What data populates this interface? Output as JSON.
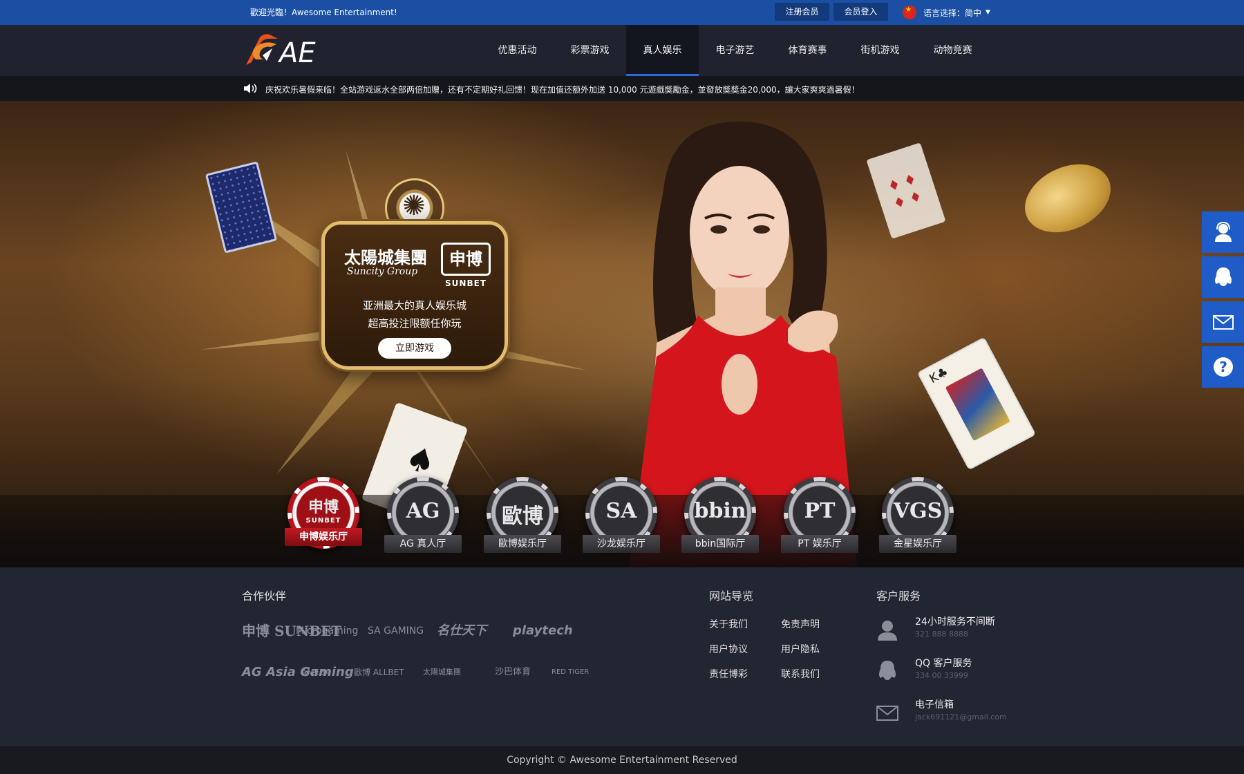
{
  "topbar": {
    "welcome": "歡迎光臨！Awesome Entertainment!",
    "register": "注册会员",
    "login": "会员登入",
    "language_label": "语言选择：简中"
  },
  "brand": {
    "logo_text": "AE",
    "accent": "#e8501d"
  },
  "nav": {
    "items": [
      "优惠活动",
      "彩票游戏",
      "真人娱乐",
      "电子游艺",
      "体育赛事",
      "街机游戏",
      "动物竞赛"
    ],
    "active_index": 2
  },
  "marquee": {
    "text": "庆祝欢乐暑假来临！全站游戏返水全部两倍加赠，还有不定期好礼回馈！现在加值还额外加送 10,000 元遊戲獎勵金，並發放獎獎金20,000，讓大家爽爽過暑假！"
  },
  "promo": {
    "brand1": "太陽城集團",
    "brand1_sub": "Suncity Group",
    "brand2": "申博",
    "brand2_sub": "SUNBET",
    "line1": "亚洲最大的真人娱乐城",
    "line2": "超高投注限额任你玩",
    "cta": "立即游戏"
  },
  "halls": [
    {
      "symbol": "申博",
      "sub": "SUNBET",
      "label": "申博娱乐厅",
      "active": true
    },
    {
      "symbol": "AG",
      "label": "AG 真人厅"
    },
    {
      "symbol": "歐博",
      "label": "歐博娱乐厅"
    },
    {
      "symbol": "SA",
      "label": "沙龙娱乐厅"
    },
    {
      "symbol": "bbin",
      "label": "bbin国际厅"
    },
    {
      "symbol": "PT",
      "label": "PT 娱乐厅"
    },
    {
      "symbol": "VGS",
      "label": "金星娱乐厅"
    }
  ],
  "sidebar": [
    "customer-service-icon",
    "qq-icon",
    "mail-icon",
    "help-icon"
  ],
  "footer": {
    "partners_title": "合作伙伴",
    "partners": [
      "申博 SUNBET",
      "Microgaming",
      "SA GAMING",
      "名仕天下",
      "playtech",
      "AG Asia Gaming",
      "AMEBA",
      "歐博 ALLBET",
      "太陽城集團",
      "沙巴体育",
      "RED TIGER"
    ],
    "nav_title": "网站导览",
    "nav_links": [
      "关于我们",
      "免责声明",
      "用户协议",
      "用户隐私",
      "责任博彩",
      "联系我们"
    ],
    "cs_title": "客户服务",
    "cs_items": [
      {
        "title": "24小时服务不间断",
        "detail": "321 888 8888"
      },
      {
        "title": "QQ 客户服务",
        "detail": "334 00 33999"
      },
      {
        "title": "电子信箱",
        "detail": "jack691121@gmail.com"
      }
    ]
  },
  "copyright": "Copyright © Awesome Entertainment Reserved"
}
